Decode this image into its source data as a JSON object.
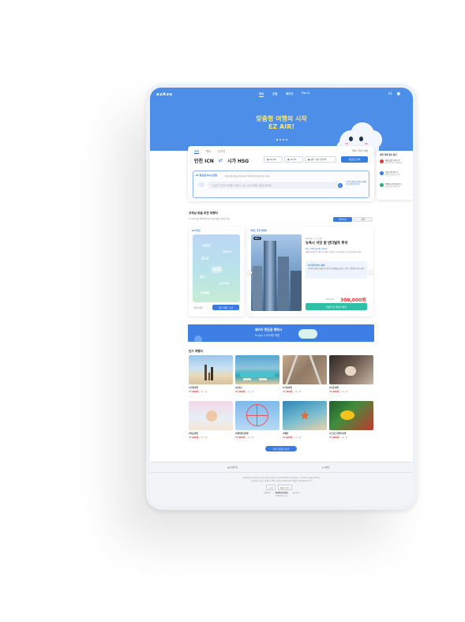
{
  "nav": {
    "logo": "ezAze",
    "links": [
      "항공",
      "호텔",
      "패키지",
      "For U"
    ],
    "active_index": 0,
    "icons": [
      "headset-icon",
      "user-icon"
    ]
  },
  "hero": {
    "title_line1": "맞춤형 여행의 시작",
    "title_line2": "EZ AIR!",
    "slides": 4,
    "active_slide": 1,
    "colors": {
      "background": "#4c8ee8",
      "title": "#ffe766"
    }
  },
  "search": {
    "tabs": [
      "왕복",
      "편도",
      "다구간"
    ],
    "active_tab": 0,
    "notice": "해외 출발편 예매",
    "origin": "인천 ICN",
    "destination": "시가 HSG",
    "date_from": "06.06",
    "date_to": "05.05",
    "passengers": "성인 1명, 일반석",
    "submit_label": "항공권 검색",
    "ai": {
      "tag": "AI 항공권 어시스턴트",
      "subtitle": "여행지와 일정을 말씀하시면 최적의 항공권을 찾아드려요",
      "placeholder": "“다음주 금요일 서울에서 제주도 가는 가장 저렴한 항공권 찾아줘”",
      "side_text": "고객님 맞춤형 일정을 추천합니다 음성 입력 가능"
    }
  },
  "side_panel": {
    "title": "여행 전에 필수 체크",
    "items": [
      {
        "text": "해외 출발 가이드북",
        "sub": "여행 전 필수 준비사항",
        "color": "#e23838"
      },
      {
        "text": "포털 추천 For U",
        "sub": "맞춤형 여행지 추천",
        "color": "#3a7be0"
      },
      {
        "text": "면세점 쇼핑 바로가기",
        "sub": "최대 할인 혜택 제공",
        "color": "#2fae74"
      }
    ]
  },
  "recommend": {
    "title": "고객님 맞춤 추천 여행지",
    "subtitle": "AI 키워드를 선택하면 맞춤 여행지를 추천해드려요",
    "toggles": [
      "일반추천",
      "테마"
    ],
    "active_toggle": 0,
    "left": {
      "header": "AI 키워드",
      "keywords": [
        "자연경관",
        "액티비티",
        "도시",
        "뉴욕",
        "휴식",
        "공식 여행",
        "문화예술"
      ],
      "footer_label": "전체 키워드",
      "button_label": "다른 키워드 보기"
    },
    "right": {
      "header": "키워드 추천 여행지",
      "badge": "BEST",
      "meta": "3박 5일 · 도시 관광",
      "title": "뉴욕시 서밋 원 반더빌트 투어",
      "tags": "#도시 #전망대 #뉴욕여행",
      "desc": "맨해튼의 새로운 랜드마크에서 뉴욕의 스카이라인을 한눈에 감상해 보세요",
      "ai_label": "AI 추천 97% 일치",
      "ai_desc": "뉴욕의 화려한 야경과 다양한 문화체험을 즐기고 싶은 고객님께 추천드려요",
      "price_label": "왕복 기준",
      "price": "300,000원",
      "cta_label": "항공권 및 패키지 예약"
    }
  },
  "banner": {
    "line1": "패키지 항공권 예약시",
    "line2": "N pay 2,000원 적립",
    "colors": {
      "background": "#3d7fe4"
    }
  },
  "popular": {
    "title": "인기 여행지",
    "tiles": [
      {
        "name": "#가족여행",
        "price": "77,900원~",
        "suffix": "1인 기준"
      },
      {
        "name": "#호캉스",
        "price": "77,900원~",
        "suffix": "1인 기준"
      },
      {
        "name": "#기차여행",
        "price": "77,900원~",
        "suffix": "1인 기준"
      },
      {
        "name": "#신혼여행",
        "price": "77,900원~",
        "suffix": "1인 기준"
      },
      {
        "name": "#태교여행",
        "price": "77,900원~",
        "suffix": "1인 기준"
      },
      {
        "name": "#테마파크여행",
        "price": "77,900원~",
        "suffix": "1인 기준"
      },
      {
        "name": "#해변",
        "price": "77,900원~",
        "suffix": "1인 기준"
      },
      {
        "name": "#스킨스쿠버다이빙",
        "price": "77,900원~",
        "suffix": "1인 기준"
      }
    ],
    "more_label": "추천 항공권 더보기"
  },
  "footer": {
    "links": [
      "공지사항",
      "이벤트"
    ],
    "company": "(주)이지에어 대표이사 홍길동 사업자등록번호 123-45-67890 통신판매업신고 제2024-서울강남-0000호",
    "address": "서울특별시 강남구 테헤란로 000 고객센터 1588-0000 이메일 help@ezaze.com",
    "selects": [
      "한국어",
      "패밀리사이트"
    ],
    "policy": [
      "이용약관",
      "개인정보처리방침",
      "회사소개"
    ],
    "copyright": "© EZAZE corp."
  }
}
